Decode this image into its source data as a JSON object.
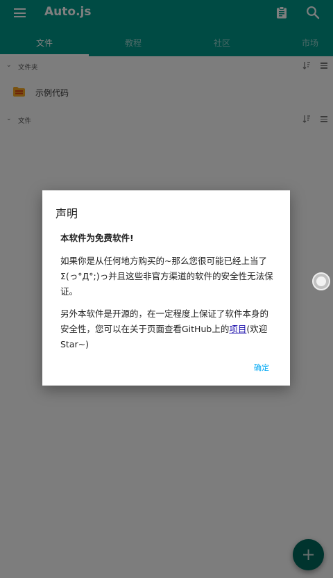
{
  "app": {
    "title": "Auto.js"
  },
  "toolbar": {
    "menu_icon": "menu-icon",
    "clip_icon": "clipboard-icon",
    "search_icon": "search-icon"
  },
  "tabs": [
    {
      "label": "文件",
      "active": true
    },
    {
      "label": "教程",
      "active": false
    },
    {
      "label": "社区",
      "active": false
    },
    {
      "label": "市场",
      "active": false
    }
  ],
  "sections": {
    "folders": {
      "label": "文件夹"
    },
    "files": {
      "label": "文件"
    }
  },
  "folder_items": [
    {
      "label": "示例代码"
    }
  ],
  "dialog": {
    "title": "声明",
    "lead": "本软件为免费软件!",
    "para1": "如果你是从任何地方购买的~那么您很可能已经上当了Σ(っ°Д°;)っ并且这些非官方渠道的软件的安全性无法保证。",
    "para2_prefix": "另外本软件是开源的，在一定程度上保证了软件本身的安全性，您可以在关于页面查看GitHub上的",
    "para2_link": "项目",
    "para2_suffix": "(欢迎Star~)",
    "ok_label": "确定"
  },
  "fab": {
    "label": "+"
  },
  "colors": {
    "primary": "#009688",
    "accent": "#03a9f4",
    "fab": "#00695c"
  }
}
